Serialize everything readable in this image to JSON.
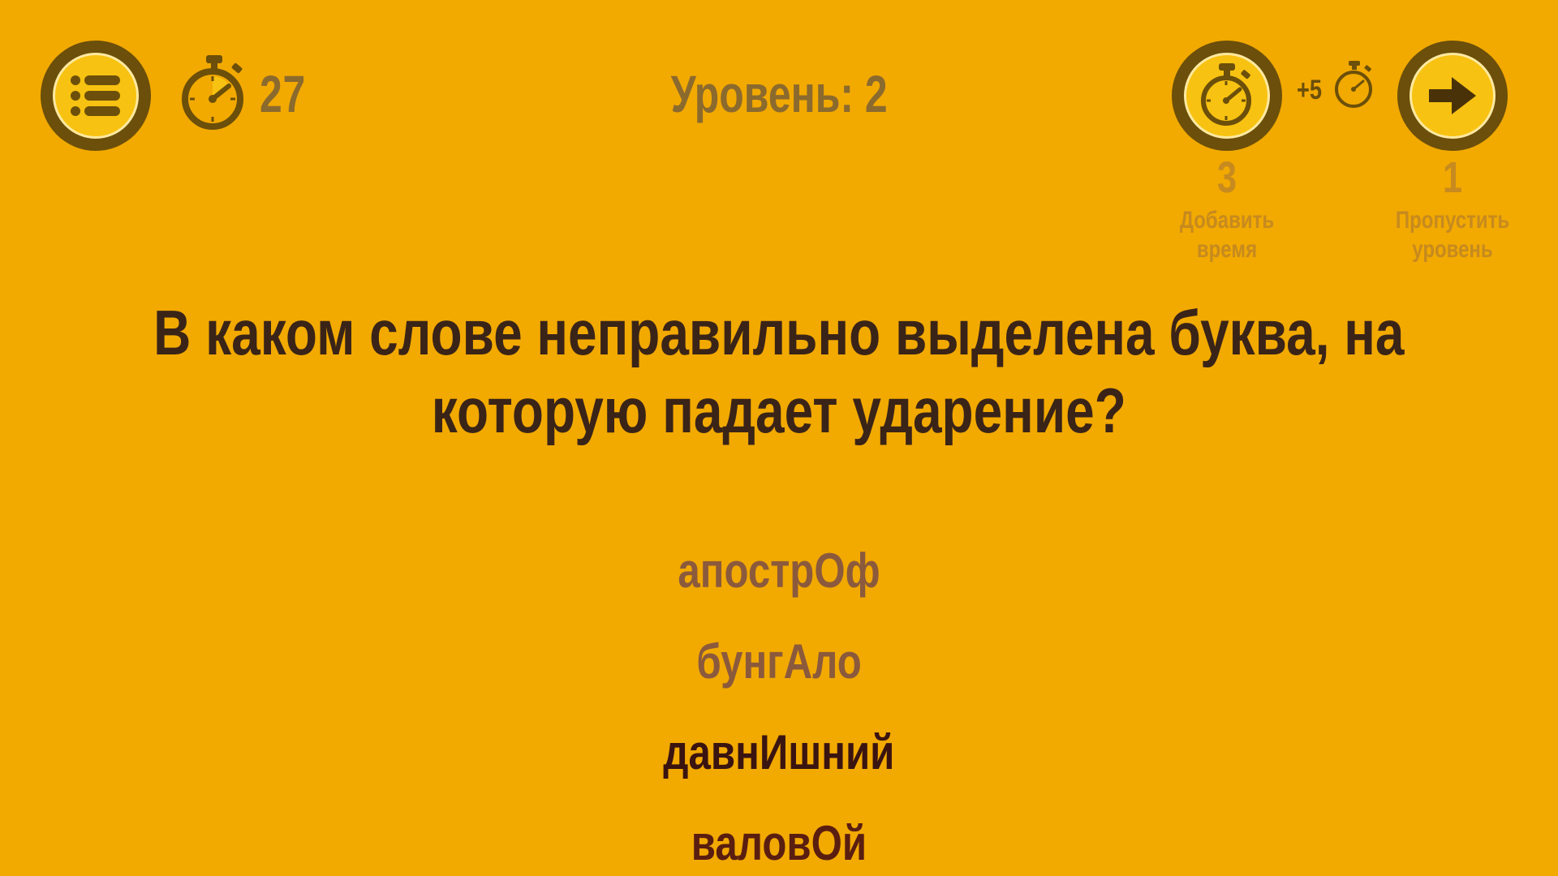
{
  "header": {
    "menu_icon": "list-icon",
    "timer_icon": "stopwatch-icon",
    "timer_value": "27",
    "level_label": "Уровень: 2"
  },
  "powerups": {
    "add_time": {
      "icon": "stopwatch-icon",
      "bonus_label": "+5",
      "count": "3",
      "caption_line1": "Добавить",
      "caption_line2": "время"
    },
    "skip": {
      "icon": "arrow-right-icon",
      "count": "1",
      "caption_line1": "Пропустить",
      "caption_line2": "уровень"
    }
  },
  "question": {
    "text": "В каком слове неправильно выделена буква, на которую падает ударение?"
  },
  "answers": [
    {
      "label": "апострОф",
      "color": "#8B5A3C"
    },
    {
      "label": "бунгАло",
      "color": "#8B5A3C"
    },
    {
      "label": "давнИшний",
      "color": "#3A1410"
    },
    {
      "label": "валовОй",
      "color": "#5A1E10"
    }
  ],
  "colors": {
    "background": "#F2A900",
    "button_ring": "#6B4F0A",
    "button_face": "#F7C211",
    "muted_text": "#8B6A2E",
    "counter_text": "#C68A1F",
    "question_text": "#3A2418"
  }
}
